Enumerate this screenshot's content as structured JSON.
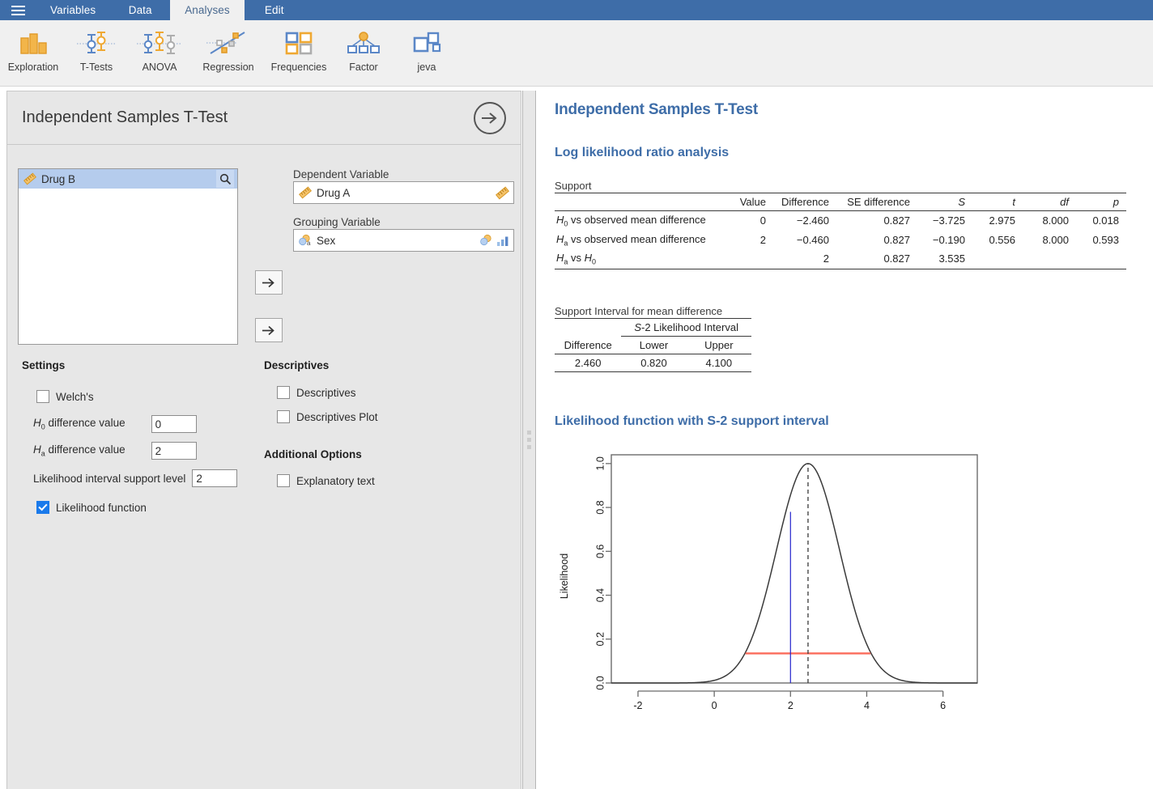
{
  "titlebar": {
    "menu_icon": "hamburger-icon",
    "tabs": [
      {
        "label": "Variables",
        "active": false
      },
      {
        "label": "Data",
        "active": false
      },
      {
        "label": "Analyses",
        "active": true
      },
      {
        "label": "Edit",
        "active": false
      }
    ]
  },
  "ribbon": {
    "buttons": [
      {
        "label": "Exploration",
        "icon": "bar-chart-icon"
      },
      {
        "label": "T-Tests",
        "icon": "t-tests-icon"
      },
      {
        "label": "ANOVA",
        "icon": "anova-icon"
      },
      {
        "label": "Regression",
        "icon": "regression-icon"
      },
      {
        "label": "Frequencies",
        "icon": "frequencies-icon"
      },
      {
        "label": "Factor",
        "icon": "factor-icon"
      },
      {
        "label": "jeva",
        "icon": "jeva-icon"
      }
    ]
  },
  "options": {
    "title": "Independent Samples T-Test",
    "ok_icon": "arrow-right-circle-icon",
    "variable_list": [
      {
        "name": "Drug B",
        "icon": "continuous-ruler-icon",
        "selected": true
      }
    ],
    "search_icon": "search-icon",
    "transfer_icon": "arrow-right-icon",
    "dependent": {
      "label": "Dependent Variable",
      "value": "Drug A",
      "icon": "continuous-ruler-icon",
      "permitted_icon": "continuous-ruler-icon"
    },
    "grouping": {
      "label": "Grouping Variable",
      "value": "Sex",
      "icon": "nominal-text-icon",
      "permitted_icons": [
        "nominal-icon",
        "ordinal-icon"
      ]
    },
    "settings": {
      "title": "Settings",
      "welch": {
        "label": "Welch's",
        "checked": false
      },
      "h0_label": "H₀ difference value",
      "h0_value": "0",
      "ha_label": "Hₐ difference value",
      "ha_value": "2",
      "interval_label": "Likelihood interval support level",
      "interval_value": "2",
      "likelihood_function": {
        "label": "Likelihood function",
        "checked": true
      }
    },
    "descriptives": {
      "title": "Descriptives",
      "items": [
        {
          "label": "Descriptives",
          "checked": false
        },
        {
          "label": "Descriptives Plot",
          "checked": false
        }
      ]
    },
    "additional": {
      "title": "Additional Options",
      "items": [
        {
          "label": "Explanatory text",
          "checked": false
        }
      ]
    }
  },
  "results": {
    "title": "Independent Samples T-Test",
    "section1": "Log likelihood ratio analysis",
    "support_table": {
      "caption": "Support",
      "columns": [
        "",
        "Value",
        "Difference",
        "SE difference",
        "S",
        "t",
        "df",
        "p"
      ],
      "rows": [
        {
          "label": "H₀ vs observed mean difference",
          "value": "0",
          "difference": "−2.460",
          "se": "0.827",
          "S": "−3.725",
          "t": "2.975",
          "df": "8.000",
          "p": "0.018"
        },
        {
          "label": "Hₐ vs observed mean difference",
          "value": "2",
          "difference": "−0.460",
          "se": "0.827",
          "S": "−0.190",
          "t": "0.556",
          "df": "8.000",
          "p": "0.593"
        },
        {
          "label": "Hₐ vs H₀",
          "value": "",
          "difference": "2",
          "se": "0.827",
          "S": "3.535",
          "t": "",
          "df": "",
          "p": ""
        }
      ]
    },
    "interval_table": {
      "caption": "Support Interval for mean difference",
      "group_header": "S-2 Likelihood Interval",
      "columns": [
        "Difference",
        "Lower",
        "Upper"
      ],
      "row": {
        "difference": "2.460",
        "lower": "0.820",
        "upper": "4.100"
      }
    },
    "section2": "Likelihood function with S-2 support interval"
  },
  "chart_data": {
    "type": "line",
    "title": "Likelihood function with S-2 support interval",
    "xlabel": "",
    "ylabel": "Likelihood",
    "xlim": [
      -2.7,
      6.9
    ],
    "ylim": [
      0.0,
      1.04
    ],
    "xticks": [
      -2,
      0,
      2,
      4,
      6
    ],
    "yticks": [
      0.0,
      0.2,
      0.4,
      0.6,
      0.8,
      1.0
    ],
    "grid": false,
    "legend": null,
    "curve": {
      "name": "Likelihood",
      "color": "#3a3a3a",
      "peak_x": 2.46,
      "peak_y": 1.0,
      "scale": 0.827,
      "description": "normal-shaped likelihood centred on the observed mean difference"
    },
    "annotations": [
      {
        "kind": "vertical-dashed-line",
        "x": 2.46,
        "y_from": 0.0,
        "y_to": 1.0,
        "color": "#3a3a3a",
        "label": "observed mean difference"
      },
      {
        "kind": "vertical-solid-line",
        "x": 2.0,
        "y_from": 0.0,
        "y_to": 0.78,
        "color": "#2323cc",
        "label": "Ha difference value"
      },
      {
        "kind": "horizontal-segment",
        "y": 0.135,
        "x_from": 0.82,
        "x_to": 4.1,
        "color": "#fb6a5a",
        "label": "S-2 support interval"
      }
    ]
  }
}
